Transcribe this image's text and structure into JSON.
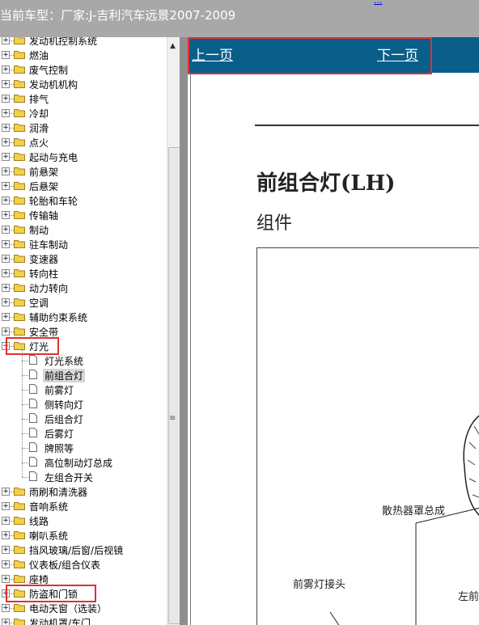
{
  "window": {
    "title": "当前车型：厂家:J-吉利汽车远景2007-2009",
    "top_link": "..."
  },
  "tree": {
    "folders_before": [
      "发动机控制系统",
      "燃油",
      "废气控制",
      "发动机机构",
      "排气",
      "冷却",
      "润滑",
      "点火",
      "起动与充电",
      "前悬架",
      "后悬架",
      "轮胎和车轮",
      "传输轴",
      "制动",
      "驻车制动",
      "变速器",
      "转向柱",
      "动力转向",
      "空调",
      "辅助约束系统",
      "安全带"
    ],
    "expanded_folder": "灯光",
    "children": [
      "灯光系统",
      "前组合灯",
      "前雾灯",
      "侧转向灯",
      "后组合灯",
      "后雾灯",
      "牌照等",
      "高位制动灯总成",
      "左组合开关"
    ],
    "selected_child": "前组合灯",
    "folders_after": [
      "雨刷和清洗器",
      "音响系统",
      "线路",
      "喇叭系统",
      "挡风玻璃/后窗/后视镜",
      "仪表板/组合仪表",
      "座椅",
      "防盗和门锁",
      "电动天窗（选装）",
      "发动机罩/车门"
    ]
  },
  "nav": {
    "prev": "上一页",
    "next": "下一页"
  },
  "doc": {
    "title": "前组合灯(LH)",
    "subtitle": "组件",
    "figure_labels": {
      "radiator": "散热器罩总成",
      "fog_connector": "前雾灯接头",
      "left": "左前"
    }
  }
}
